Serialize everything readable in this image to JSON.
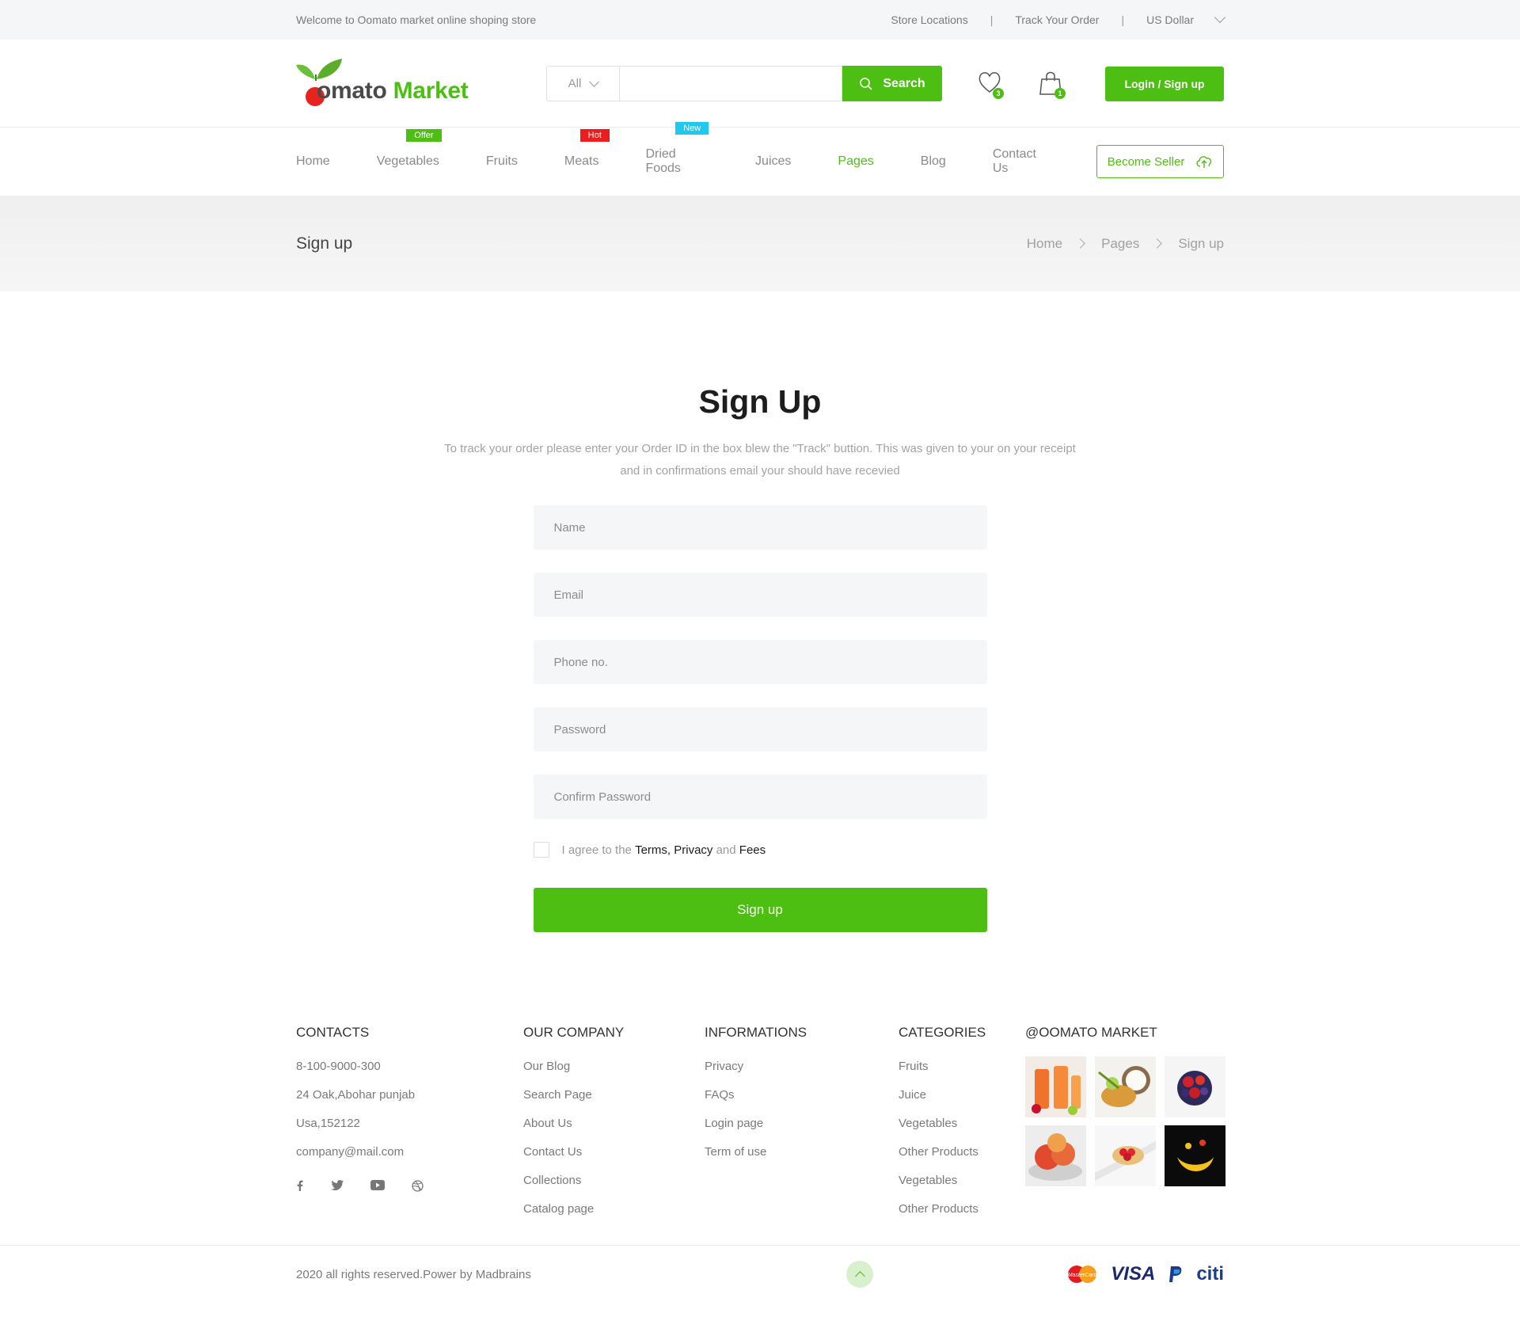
{
  "topbar": {
    "welcome": "Welcome to Oomato market online shoping store",
    "store_locations": "Store Locations",
    "track_order": "Track Your Order",
    "currency": "US Dollar",
    "separator": "|"
  },
  "header": {
    "brand_first": "omato",
    "brand_second": "Market",
    "search_category": "All",
    "search_value": "",
    "search_button": "Search",
    "wishlist_count": "3",
    "cart_count": "1",
    "login_button": "Login / Sign up"
  },
  "nav": {
    "items": [
      {
        "label": "Home"
      },
      {
        "label": "Vegetables",
        "tag": "Offer"
      },
      {
        "label": "Fruits"
      },
      {
        "label": "Meats",
        "tag": "Hot"
      },
      {
        "label": "Dried Foods",
        "tag": "New"
      },
      {
        "label": "Juices"
      },
      {
        "label": "Pages"
      },
      {
        "label": "Blog"
      },
      {
        "label": "Contact Us"
      }
    ],
    "active": "Pages",
    "seller_button": "Become Seller"
  },
  "banner": {
    "title": "Sign up",
    "crumbs": [
      "Home",
      "Pages",
      "Sign up"
    ]
  },
  "form": {
    "title": "Sign Up",
    "description": "To track your order please enter your Order ID in the box blew the \"Track\" buttion. This was given to your on your receipt and in confirmations email your should have recevied",
    "fields": {
      "name": "Name",
      "email": "Email",
      "phone": "Phone no.",
      "password": "Password",
      "confirm": "Confirm Password"
    },
    "agree_prefix": "I agree to the",
    "agree_terms": "Terms, Privacy",
    "agree_and": "and",
    "agree_fees": "Fees",
    "submit": "Sign up"
  },
  "footer": {
    "contacts": {
      "title": "CONTACTS",
      "lines": [
        "8-100-9000-300",
        "24 Oak,Abohar punjab",
        "Usa,152122",
        "company@mail.com"
      ]
    },
    "company": {
      "title": "OUR COMPANY",
      "links": [
        "Our Blog",
        "Search Page",
        "About Us",
        "Contact Us",
        "Collections",
        "Catalog page"
      ]
    },
    "informations": {
      "title": "INFORMATIONS",
      "links": [
        "Privacy",
        "FAQs",
        "Login page",
        "Term of use"
      ]
    },
    "categories": {
      "title": "CATEGORIES",
      "links": [
        "Fruits",
        "Juice",
        "Vegetables",
        "Other Products",
        "Vegetables",
        "Other Products"
      ]
    },
    "instagram": {
      "title": "@OOMATO MARKET"
    },
    "copyright": "2020 all rights reserved.Power by Madbrains",
    "payments": {
      "visa": "VISA",
      "mastercard": "MasterCard",
      "citi": "citi"
    }
  },
  "colors": {
    "accent": "#4cbf12",
    "hot": "#ee1d1d",
    "new": "#1ec8ef"
  }
}
